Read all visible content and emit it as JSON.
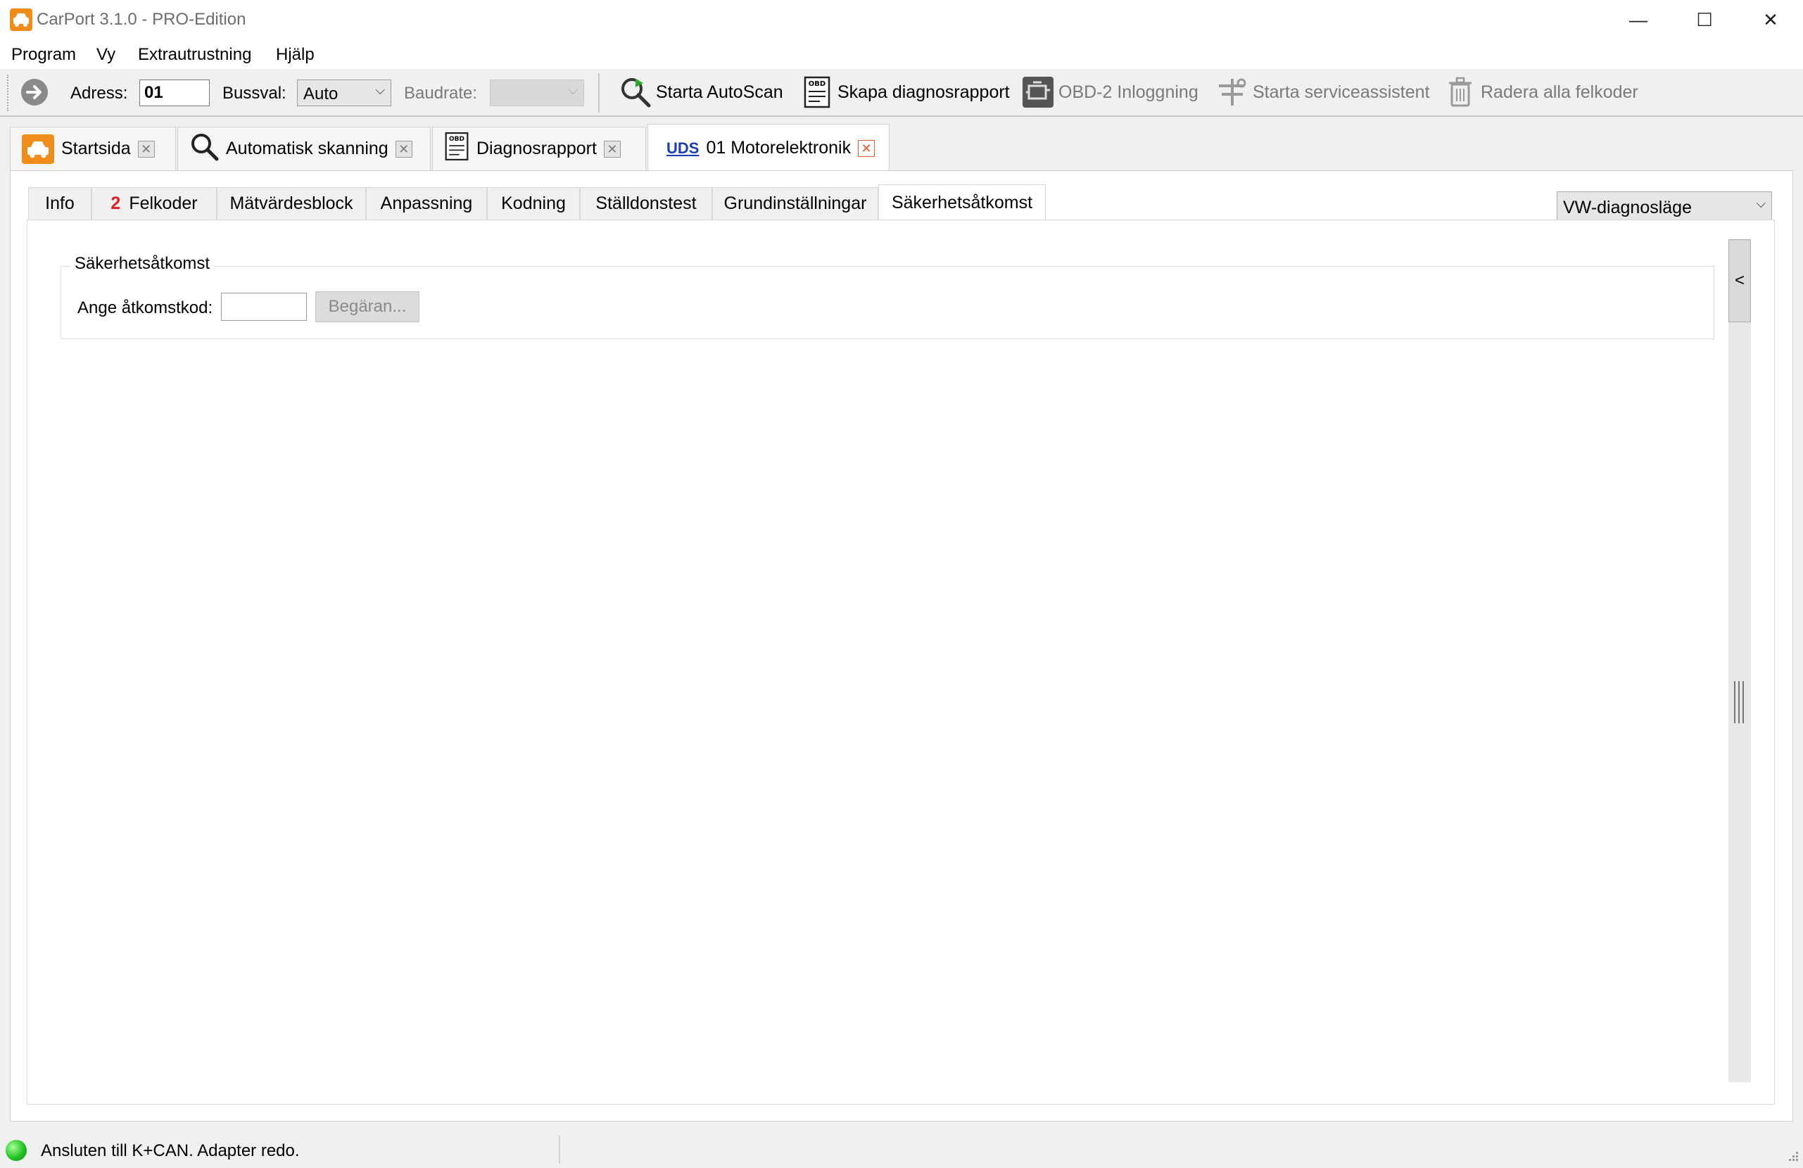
{
  "window": {
    "title": "CarPort 3.1.0 - PRO-Edition",
    "minimize": "—",
    "maximize": "☐",
    "close": "✕"
  },
  "menu": [
    "Program",
    "Vy",
    "Extrautrustning",
    "Hjälp"
  ],
  "toolbar": {
    "address_label": "Adress:",
    "address_value": "01",
    "bus_label": "Bussval:",
    "bus_value": "Auto",
    "baud_label": "Baudrate:",
    "baud_value": "",
    "buttons": {
      "autoscan": "Starta AutoScan",
      "report": "Skapa diagnosrapport",
      "obd": "OBD-2 Inloggning",
      "service": "Starta serviceassistent",
      "clear": "Radera alla felkoder"
    }
  },
  "doc_tabs": {
    "start": "Startsida",
    "scan": "Automatisk skanning",
    "report": "Diagnosrapport",
    "uds_badge": "UDS",
    "module": "01 Motorelektronik"
  },
  "sub_tabs": {
    "info": "Info",
    "fault_count": "2",
    "faults": "Felkoder",
    "measure": "Mätvärdesblock",
    "adapt": "Anpassning",
    "coding": "Kodning",
    "actuator": "Ställdonstest",
    "basic": "Grundinställningar",
    "security": "Säkerhetsåtkomst"
  },
  "mode_select": "VW-diagnosläge",
  "security": {
    "group_title": "Säkerhetsåtkomst",
    "code_label": "Ange åtkomstkod:",
    "code_value": "",
    "request_button": "Begäran..."
  },
  "side_toggle": "<",
  "status": {
    "text": "Ansluten till K+CAN. Adapter redo.",
    "led_color": "#22c322"
  }
}
